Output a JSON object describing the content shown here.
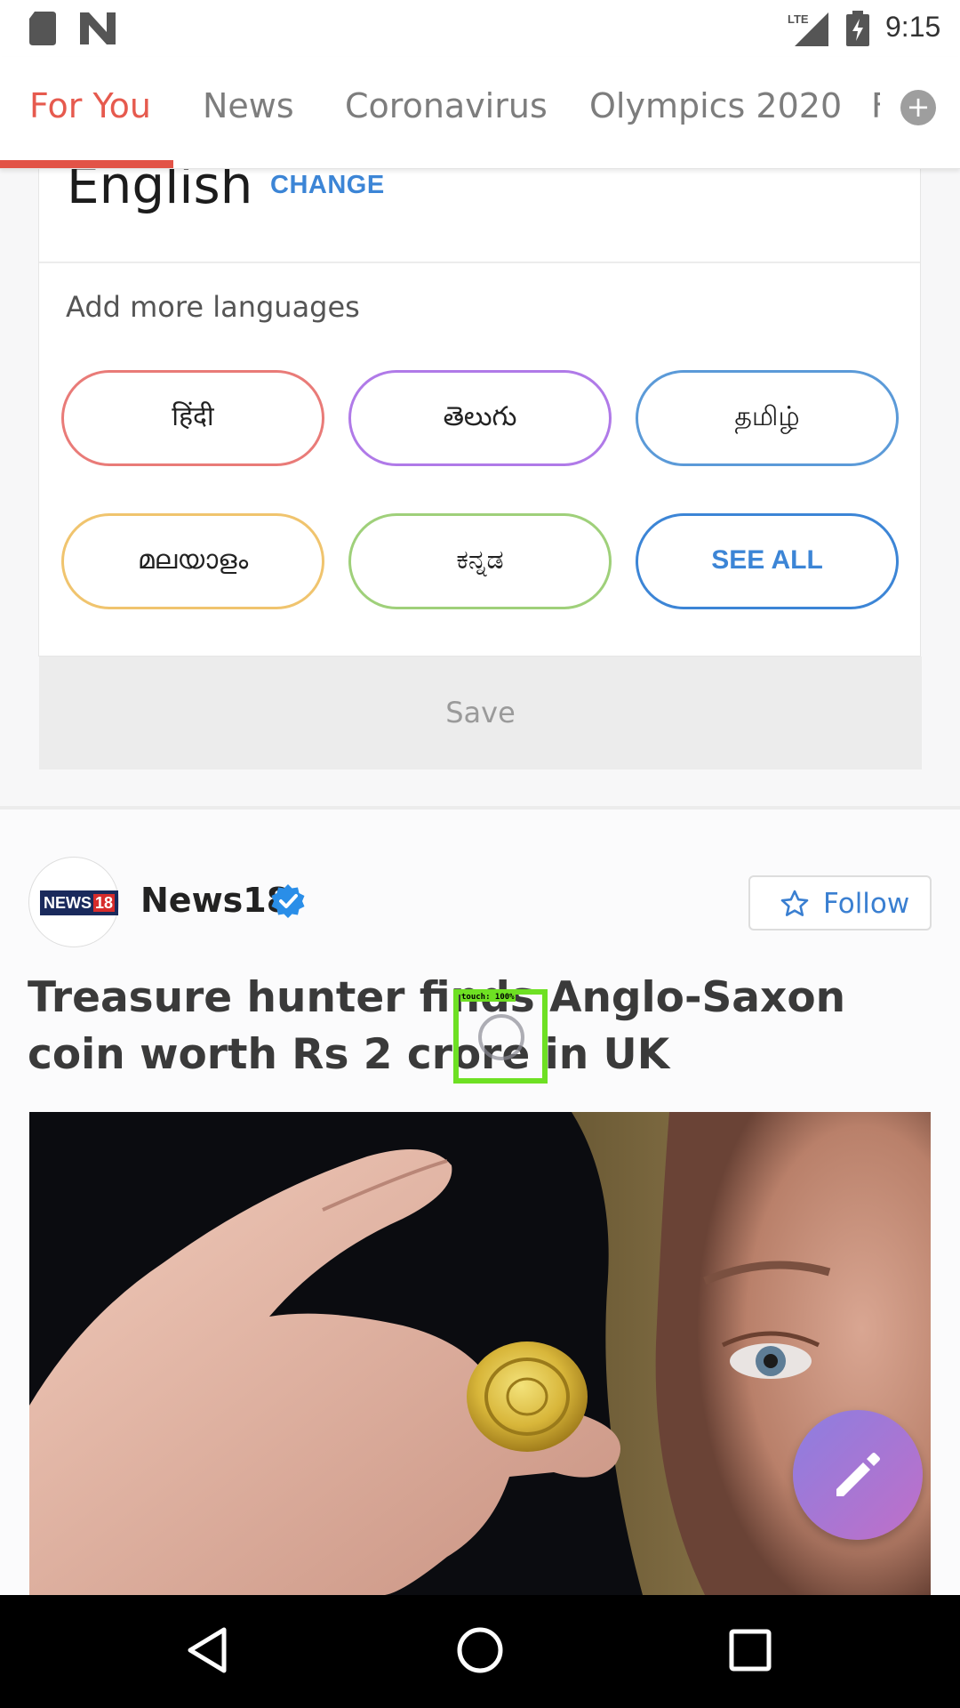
{
  "status_bar": {
    "time": "9:15",
    "network": "LTE",
    "icons": [
      "sd-card-icon",
      "n-notification-icon",
      "lte-signal-icon",
      "battery-charging-icon"
    ]
  },
  "tabs": [
    {
      "label": "For You",
      "active": true
    },
    {
      "label": "News",
      "active": false
    },
    {
      "label": "Coronavirus",
      "active": false
    },
    {
      "label": "Olympics 2020",
      "active": false
    },
    {
      "label": "F",
      "active": false
    }
  ],
  "tab_add_label": "+",
  "language_card": {
    "current_language": "English",
    "change_label": "CHANGE",
    "add_more_label": "Add more languages",
    "languages": [
      {
        "label": "हिंदी",
        "color": "#e97b78"
      },
      {
        "label": "తెలుగు",
        "color": "#b07ae8"
      },
      {
        "label": "தமிழ்",
        "color": "#5b9ad8"
      },
      {
        "label": "മലയാളം",
        "color": "#f0c46e"
      },
      {
        "label": "ಕನ್ನಡ",
        "color": "#9fd07a"
      }
    ],
    "see_all_label": "SEE ALL",
    "save_label": "Save"
  },
  "post": {
    "publisher": "News18",
    "logo_text": "NEWS",
    "logo_number": "18",
    "verified": true,
    "follow_label": "Follow",
    "headline": "Treasure hunter finds Anglo-Saxon coin worth Rs 2 crore in UK",
    "image_description_icon": "gold-coin-image"
  },
  "touch_overlay": {
    "label": "touch: 100%"
  },
  "colors": {
    "accent": "#e65a4e",
    "link": "#3c85d6",
    "fab_start": "#8c7ee0",
    "fab_end": "#c06fc8"
  }
}
